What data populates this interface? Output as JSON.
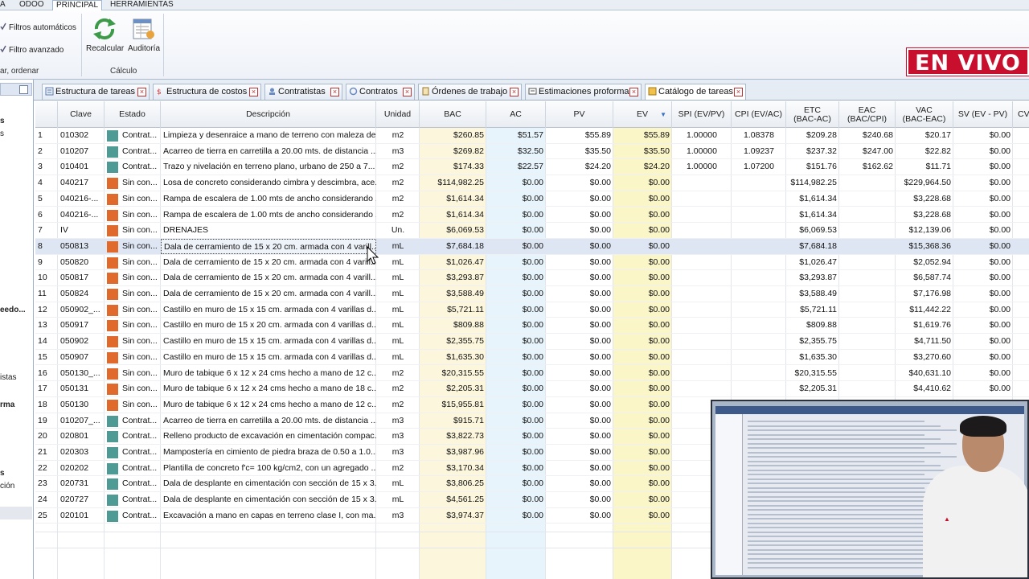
{
  "menu_tabs": [
    "A",
    "ODOO",
    "PRINCIPAL",
    "HERRAMIENTAS"
  ],
  "ribbon": {
    "filters_auto": "Filtros automáticos",
    "filters_adv": "Filtro avanzado",
    "group_left": "ar, ordenar",
    "recalc": "Recalcular",
    "audit": "Auditoría",
    "group_calc": "Cálculo"
  },
  "left_panel": {
    "items": [
      "s",
      "s",
      "eedo...",
      "istas",
      "rma",
      "s",
      "ción"
    ]
  },
  "doc_tabs": [
    "Estructura de tareas",
    "Estructura de costos",
    "Contratistas",
    "Contratos",
    "Órdenes de trabajo",
    "Estimaciones proforma",
    "Catálogo de tareas"
  ],
  "live_badge": "EN VIVO",
  "colors": {
    "contratado": "#4e9a94",
    "sin_contratar": "#e06a2c",
    "bac_col": "#fbf6dc",
    "ac_col": "#e6f4fb",
    "ev_col": "#fbf6c8",
    "live_red": "#c8102e"
  },
  "columns": [
    "",
    "Clave",
    "Estado",
    "Descripción",
    "Unidad",
    "BAC",
    "AC",
    "PV",
    "EV",
    "SPI (EV/PV)",
    "CPI (EV/AC)",
    "ETC\n(BAC-AC)",
    "EAC\n(BAC/CPI)",
    "VAC\n(BAC-EAC)",
    "SV  (EV - PV)",
    "CV"
  ],
  "rows": [
    {
      "n": "1",
      "clave": "010302",
      "estado": "Contrat...",
      "tipo": "c",
      "desc": "Limpieza y desenraice a mano de terreno con maleza de...",
      "unidad": "m2",
      "bac": "$260.85",
      "ac": "$51.57",
      "pv": "$55.89",
      "ev": "$55.89",
      "spi": "1.00000",
      "cpi": "1.08378",
      "etc": "$209.28",
      "eac": "$240.68",
      "vac": "$20.17",
      "sv": "$0.00"
    },
    {
      "n": "2",
      "clave": "010207",
      "estado": "Contrat...",
      "tipo": "c",
      "desc": "Acarreo de tierra en carretilla a 20.00 mts. de distancia ...",
      "unidad": "m3",
      "bac": "$269.82",
      "ac": "$32.50",
      "pv": "$35.50",
      "ev": "$35.50",
      "spi": "1.00000",
      "cpi": "1.09237",
      "etc": "$237.32",
      "eac": "$247.00",
      "vac": "$22.82",
      "sv": "$0.00"
    },
    {
      "n": "3",
      "clave": "010401",
      "estado": "Contrat...",
      "tipo": "c",
      "desc": "Trazo y nivelación en terreno plano, urbano de 250 a 7...",
      "unidad": "m2",
      "bac": "$174.33",
      "ac": "$22.57",
      "pv": "$24.20",
      "ev": "$24.20",
      "spi": "1.00000",
      "cpi": "1.07200",
      "etc": "$151.76",
      "eac": "$162.62",
      "vac": "$11.71",
      "sv": "$0.00"
    },
    {
      "n": "4",
      "clave": "040217",
      "estado": "Sin con...",
      "tipo": "s",
      "desc": "Losa de concreto considerando cimbra y descimbra, ace...",
      "unidad": "m2",
      "bac": "$114,982.25",
      "ac": "$0.00",
      "pv": "$0.00",
      "ev": "$0.00",
      "spi": "",
      "cpi": "",
      "etc": "$114,982.25",
      "eac": "",
      "vac": "$229,964.50",
      "sv": "$0.00"
    },
    {
      "n": "5",
      "clave": "040216-...",
      "estado": "Sin con...",
      "tipo": "s",
      "desc": "Rampa de escalera de 1.00 mts de ancho considerando ...",
      "unidad": "m2",
      "bac": "$1,614.34",
      "ac": "$0.00",
      "pv": "$0.00",
      "ev": "$0.00",
      "spi": "",
      "cpi": "",
      "etc": "$1,614.34",
      "eac": "",
      "vac": "$3,228.68",
      "sv": "$0.00"
    },
    {
      "n": "6",
      "clave": "040216-...",
      "estado": "Sin con...",
      "tipo": "s",
      "desc": "Rampa de escalera de 1.00 mts de ancho considerando ...",
      "unidad": "m2",
      "bac": "$1,614.34",
      "ac": "$0.00",
      "pv": "$0.00",
      "ev": "$0.00",
      "spi": "",
      "cpi": "",
      "etc": "$1,614.34",
      "eac": "",
      "vac": "$3,228.68",
      "sv": "$0.00"
    },
    {
      "n": "7",
      "clave": "IV",
      "estado": "Sin con...",
      "tipo": "s",
      "desc": "DRENAJES",
      "unidad": "Un.",
      "bac": "$6,069.53",
      "ac": "$0.00",
      "pv": "$0.00",
      "ev": "$0.00",
      "spi": "",
      "cpi": "",
      "etc": "$6,069.53",
      "eac": "",
      "vac": "$12,139.06",
      "sv": "$0.00"
    },
    {
      "n": "8",
      "clave": "050813",
      "estado": "Sin con...",
      "tipo": "s",
      "desc": "Dala de cerramiento de 15 x 20 cm. armada con 4 varill...",
      "unidad": "mL",
      "bac": "$7,684.18",
      "ac": "$0.00",
      "pv": "$0.00",
      "ev": "$0.00",
      "spi": "",
      "cpi": "",
      "etc": "$7,684.18",
      "eac": "",
      "vac": "$15,368.36",
      "sv": "$0.00"
    },
    {
      "n": "9",
      "clave": "050820",
      "estado": "Sin con...",
      "tipo": "s",
      "desc": "Dala de cerramiento de 15 x 20 cm. armada con 4 varill...",
      "unidad": "mL",
      "bac": "$1,026.47",
      "ac": "$0.00",
      "pv": "$0.00",
      "ev": "$0.00",
      "spi": "",
      "cpi": "",
      "etc": "$1,026.47",
      "eac": "",
      "vac": "$2,052.94",
      "sv": "$0.00"
    },
    {
      "n": "10",
      "clave": "050817",
      "estado": "Sin con...",
      "tipo": "s",
      "desc": "Dala de cerramiento de 15 x 20 cm. armada con 4 varill...",
      "unidad": "mL",
      "bac": "$3,293.87",
      "ac": "$0.00",
      "pv": "$0.00",
      "ev": "$0.00",
      "spi": "",
      "cpi": "",
      "etc": "$3,293.87",
      "eac": "",
      "vac": "$6,587.74",
      "sv": "$0.00"
    },
    {
      "n": "11",
      "clave": "050824",
      "estado": "Sin con...",
      "tipo": "s",
      "desc": "Dala de cerramiento de 15 x 20 cm. armada con 4 varill...",
      "unidad": "mL",
      "bac": "$3,588.49",
      "ac": "$0.00",
      "pv": "$0.00",
      "ev": "$0.00",
      "spi": "",
      "cpi": "",
      "etc": "$3,588.49",
      "eac": "",
      "vac": "$7,176.98",
      "sv": "$0.00"
    },
    {
      "n": "12",
      "clave": "050902_...",
      "estado": "Sin con...",
      "tipo": "s",
      "desc": "Castillo en muro de 15 x 15 cm. armada con 4 varillas d...",
      "unidad": "mL",
      "bac": "$5,721.11",
      "ac": "$0.00",
      "pv": "$0.00",
      "ev": "$0.00",
      "spi": "",
      "cpi": "",
      "etc": "$5,721.11",
      "eac": "",
      "vac": "$11,442.22",
      "sv": "$0.00"
    },
    {
      "n": "13",
      "clave": "050917",
      "estado": "Sin con...",
      "tipo": "s",
      "desc": "Castillo en muro de 15 x 20 cm. armada con 4 varillas d...",
      "unidad": "mL",
      "bac": "$809.88",
      "ac": "$0.00",
      "pv": "$0.00",
      "ev": "$0.00",
      "spi": "",
      "cpi": "",
      "etc": "$809.88",
      "eac": "",
      "vac": "$1,619.76",
      "sv": "$0.00"
    },
    {
      "n": "14",
      "clave": "050902",
      "estado": "Sin con...",
      "tipo": "s",
      "desc": "Castillo en muro de 15 x 15 cm. armada con 4 varillas d...",
      "unidad": "mL",
      "bac": "$2,355.75",
      "ac": "$0.00",
      "pv": "$0.00",
      "ev": "$0.00",
      "spi": "",
      "cpi": "",
      "etc": "$2,355.75",
      "eac": "",
      "vac": "$4,711.50",
      "sv": "$0.00"
    },
    {
      "n": "15",
      "clave": "050907",
      "estado": "Sin con...",
      "tipo": "s",
      "desc": "Castillo en muro de 15 x 15 cm. armada con 4 varillas d...",
      "unidad": "mL",
      "bac": "$1,635.30",
      "ac": "$0.00",
      "pv": "$0.00",
      "ev": "$0.00",
      "spi": "",
      "cpi": "",
      "etc": "$1,635.30",
      "eac": "",
      "vac": "$3,270.60",
      "sv": "$0.00"
    },
    {
      "n": "16",
      "clave": "050130_...",
      "estado": "Sin con...",
      "tipo": "s",
      "desc": "Muro de tabique 6 x 12 x 24 cms hecho a mano de 12 c...",
      "unidad": "m2",
      "bac": "$20,315.55",
      "ac": "$0.00",
      "pv": "$0.00",
      "ev": "$0.00",
      "spi": "",
      "cpi": "",
      "etc": "$20,315.55",
      "eac": "",
      "vac": "$40,631.10",
      "sv": "$0.00"
    },
    {
      "n": "17",
      "clave": "050131",
      "estado": "Sin con...",
      "tipo": "s",
      "desc": "Muro de tabique 6 x 12 x 24 cms hecho a mano de 18 c...",
      "unidad": "m2",
      "bac": "$2,205.31",
      "ac": "$0.00",
      "pv": "$0.00",
      "ev": "$0.00",
      "spi": "",
      "cpi": "",
      "etc": "$2,205.31",
      "eac": "",
      "vac": "$4,410.62",
      "sv": "$0.00"
    },
    {
      "n": "18",
      "clave": "050130",
      "estado": "Sin con...",
      "tipo": "s",
      "desc": "Muro de tabique 6 x 12 x 24 cms hecho a mano de 12 c...",
      "unidad": "m2",
      "bac": "$15,955.81",
      "ac": "$0.00",
      "pv": "$0.00",
      "ev": "$0.00",
      "spi": "",
      "cpi": "",
      "etc": "",
      "eac": "",
      "vac": "",
      "sv": ""
    },
    {
      "n": "19",
      "clave": "010207_...",
      "estado": "Contrat...",
      "tipo": "c",
      "desc": "Acarreo de tierra en carretilla a 20.00 mts. de distancia ...",
      "unidad": "m3",
      "bac": "$915.71",
      "ac": "$0.00",
      "pv": "$0.00",
      "ev": "$0.00",
      "spi": "",
      "cpi": "",
      "etc": "",
      "eac": "",
      "vac": "",
      "sv": ""
    },
    {
      "n": "20",
      "clave": "020801",
      "estado": "Contrat...",
      "tipo": "c",
      "desc": "Relleno producto de excavación en cimentación compac...",
      "unidad": "m3",
      "bac": "$3,822.73",
      "ac": "$0.00",
      "pv": "$0.00",
      "ev": "$0.00",
      "spi": "",
      "cpi": "",
      "etc": "",
      "eac": "",
      "vac": "",
      "sv": ""
    },
    {
      "n": "21",
      "clave": "020303",
      "estado": "Contrat...",
      "tipo": "c",
      "desc": "Mampostería en cimiento de piedra braza de 0.50 a 1.0...",
      "unidad": "m3",
      "bac": "$3,987.96",
      "ac": "$0.00",
      "pv": "$0.00",
      "ev": "$0.00",
      "spi": "",
      "cpi": "",
      "etc": "",
      "eac": "",
      "vac": "",
      "sv": ""
    },
    {
      "n": "22",
      "clave": "020202",
      "estado": "Contrat...",
      "tipo": "c",
      "desc": "Plantilla de concreto f'c= 100 kg/cm2, con un agregado ...",
      "unidad": "m2",
      "bac": "$3,170.34",
      "ac": "$0.00",
      "pv": "$0.00",
      "ev": "$0.00",
      "spi": "",
      "cpi": "",
      "etc": "",
      "eac": "",
      "vac": "",
      "sv": ""
    },
    {
      "n": "23",
      "clave": "020731",
      "estado": "Contrat...",
      "tipo": "c",
      "desc": "Dala de desplante en cimentación con sección de 15 x 3...",
      "unidad": "mL",
      "bac": "$3,806.25",
      "ac": "$0.00",
      "pv": "$0.00",
      "ev": "$0.00",
      "spi": "",
      "cpi": "",
      "etc": "",
      "eac": "",
      "vac": "",
      "sv": ""
    },
    {
      "n": "24",
      "clave": "020727",
      "estado": "Contrat...",
      "tipo": "c",
      "desc": "Dala de desplante en cimentación con sección de 15 x 3...",
      "unidad": "mL",
      "bac": "$4,561.25",
      "ac": "$0.00",
      "pv": "$0.00",
      "ev": "$0.00",
      "spi": "",
      "cpi": "",
      "etc": "",
      "eac": "",
      "vac": "",
      "sv": ""
    },
    {
      "n": "25",
      "clave": "020101",
      "estado": "Contrat...",
      "tipo": "c",
      "desc": "Excavación a mano en capas en terreno clase I, con ma...",
      "unidad": "m3",
      "bac": "$3,974.37",
      "ac": "$0.00",
      "pv": "$0.00",
      "ev": "$0.00",
      "spi": "",
      "cpi": "",
      "etc": "",
      "eac": "",
      "vac": "",
      "sv": ""
    }
  ],
  "selected_row": 8
}
